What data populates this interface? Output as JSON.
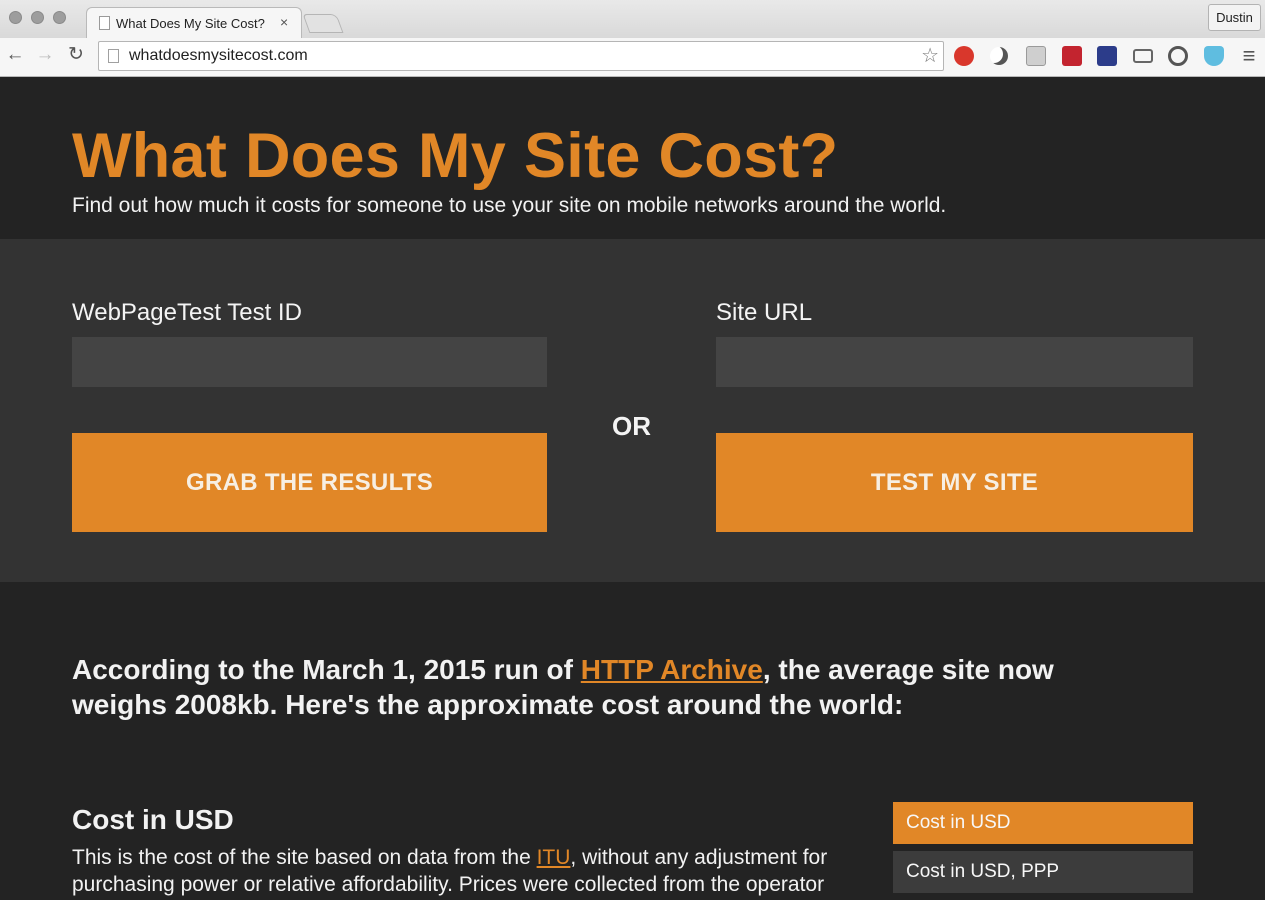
{
  "browser": {
    "tab_title": "What Does My Site Cost?",
    "tab_close": "×",
    "profile_name": "Dustin",
    "url": "whatdoesmysitecost.com",
    "back_glyph": "←",
    "forward_glyph": "→",
    "reload_glyph": "↻",
    "star_glyph": "☆",
    "menu_glyph": "≡"
  },
  "hero": {
    "title": "What Does My Site Cost?",
    "tagline": "Find out how much it costs for someone to use your site on mobile networks around the world."
  },
  "form": {
    "test_id_label": "WebPageTest Test ID",
    "test_id_value": "",
    "site_url_label": "Site URL",
    "site_url_value": "",
    "or_label": "OR",
    "grab_button": "GRAB THE RESULTS",
    "test_button": "TEST MY SITE"
  },
  "results": {
    "summary_prefix": "According to the March 1, 2015 run of ",
    "summary_link": "HTTP Archive",
    "summary_suffix": ", the average site now weighs 2008kb. Here's the approximate cost around the world:",
    "section_title": "Cost in USD",
    "desc_prefix": "This is the cost of the site based on data from the ",
    "desc_link": "ITU",
    "desc_suffix": ", without any adjustment for purchasing power or relative affordability. Prices were collected from the operator",
    "side_tabs": [
      {
        "label": "Cost in USD",
        "active": true
      },
      {
        "label": "Cost in USD, PPP",
        "active": false
      }
    ]
  },
  "colors": {
    "accent": "#e18727",
    "dark_bg": "#232323",
    "band_bg": "#333333",
    "input_bg": "#444444"
  }
}
